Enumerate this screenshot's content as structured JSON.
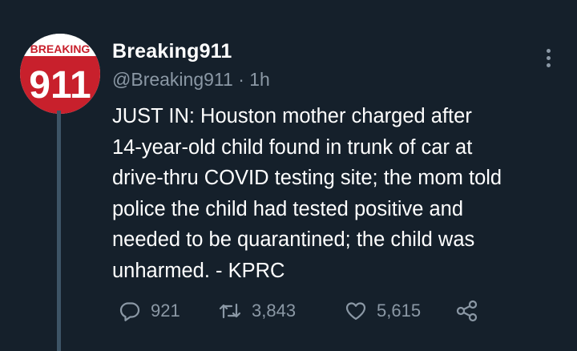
{
  "tweet": {
    "avatar_text": {
      "top": "BREAKING",
      "bottom": "911"
    },
    "display_name": "Breaking911",
    "handle": "@Breaking911",
    "separator": "·",
    "time": "1h",
    "text": "JUST IN: Houston mother charged after\n14-year-old child found in trunk of car at\ndrive-thru COVID testing site; the mom told\npolice the child had tested positive and\nneeded to be quarantined; the child was\nunharmed. - KPRC",
    "actions": {
      "reply_icon": "reply-icon",
      "reply_count": "921",
      "retweet_icon": "retweet-icon",
      "retweet_count": "3,843",
      "like_icon": "heart-icon",
      "like_count": "5,615",
      "share_icon": "share-icon"
    }
  },
  "colors": {
    "background": "#15202b",
    "secondary_text": "#8b98a5",
    "avatar_red": "#c8202c",
    "thread_line": "#3d5466"
  }
}
